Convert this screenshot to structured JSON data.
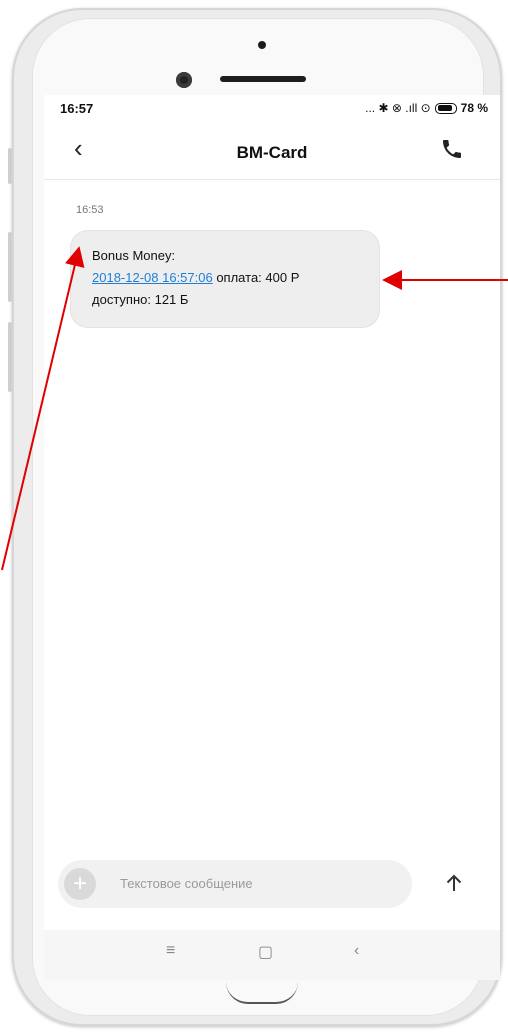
{
  "status_bar": {
    "time": "16:57",
    "icons_text": "... ✱ ⊗ .ıll ⊙",
    "battery_percent": "78 %"
  },
  "header": {
    "back_icon": "chevron-left-icon",
    "title": "BM-Card",
    "call_icon": "phone-icon"
  },
  "conversation": {
    "timestamp": "16:53",
    "message": {
      "line1": "Bonus Money:",
      "link_text": "2018-12-08 16:57:06",
      "line2_rest": " оплата: 400 Р",
      "line3": "доступно: 121 Б"
    }
  },
  "composer": {
    "placeholder": "Текстовое сообщение",
    "add_icon": "plus-icon",
    "send_icon": "arrow-up-icon"
  },
  "navbar": {
    "menu_icon": "≡",
    "home_icon": "▢",
    "back_icon": "‹"
  },
  "colors": {
    "link": "#1f7fd6",
    "annotation_arrow": "#e00000",
    "bubble": "#eeeeee"
  }
}
